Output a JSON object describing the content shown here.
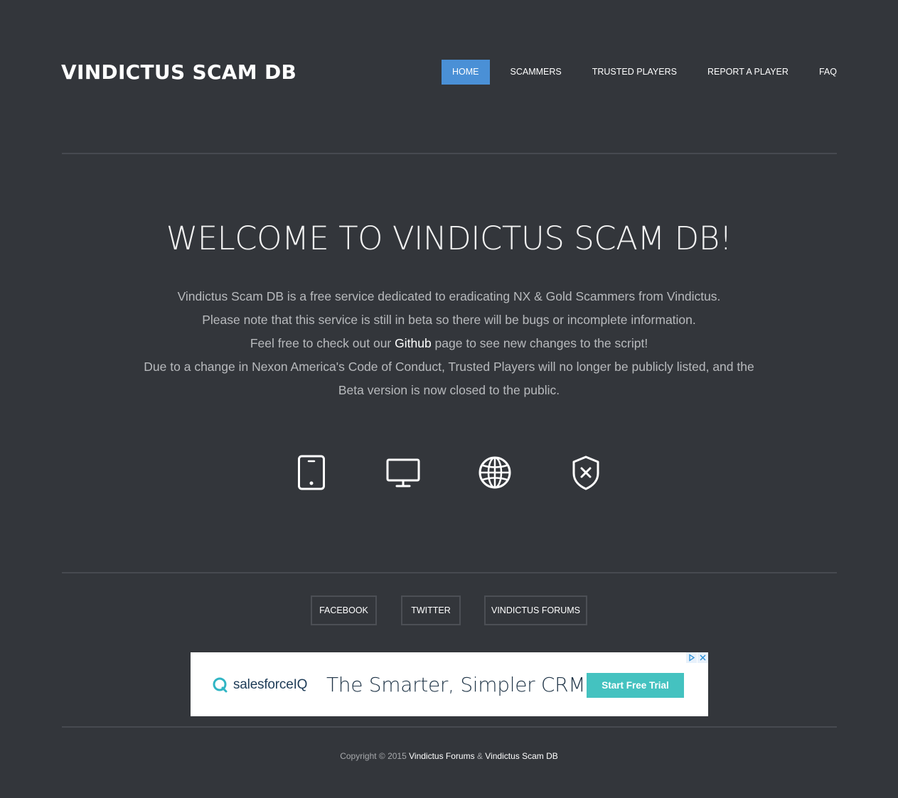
{
  "site": {
    "title": "VINDICTUS SCAM DB"
  },
  "nav": {
    "items": [
      {
        "label": "HOME",
        "active": true
      },
      {
        "label": "SCAMMERS",
        "active": false
      },
      {
        "label": "TRUSTED PLAYERS",
        "active": false
      },
      {
        "label": "REPORT A PLAYER",
        "active": false
      },
      {
        "label": "FAQ",
        "active": false
      }
    ],
    "active_color": "#4a90d6"
  },
  "hero": {
    "title": "WELCOME TO VINDICTUS SCAM DB!",
    "line1": "Vindictus Scam DB is a free service dedicated to eradicating NX & Gold Scammers from Vindictus.",
    "line2": "Please note that this service is still in beta so there will be bugs or incomplete information.",
    "line3_before": "Feel free to check out our ",
    "line3_link": "Github",
    "line3_after": " page to see new changes to the script!",
    "line4": "Due to a change in Nexon America's Code of Conduct, Trusted Players will no longer be publicly listed, and the Beta version is now closed to the public."
  },
  "features": {
    "icons": [
      "tablet-icon",
      "desktop-icon",
      "globe-icon",
      "shield-x-icon"
    ]
  },
  "social": {
    "facebook": "FACEBOOK",
    "twitter": "TWITTER",
    "forums": "VINDICTUS FORUMS"
  },
  "ad": {
    "brand": "salesforceIQ",
    "headline": "The Smarter, Simpler CRM",
    "cta": "Start Free Trial",
    "brand_color": "#1d3b57",
    "cta_color": "#44c2c0"
  },
  "footer": {
    "prefix": "Copyright © 2015 ",
    "link1": "Vindictus Forums",
    "separator": " & ",
    "link2": "Vindictus Scam DB"
  },
  "colors": {
    "background": "#33363b",
    "rule": "#474a50"
  }
}
